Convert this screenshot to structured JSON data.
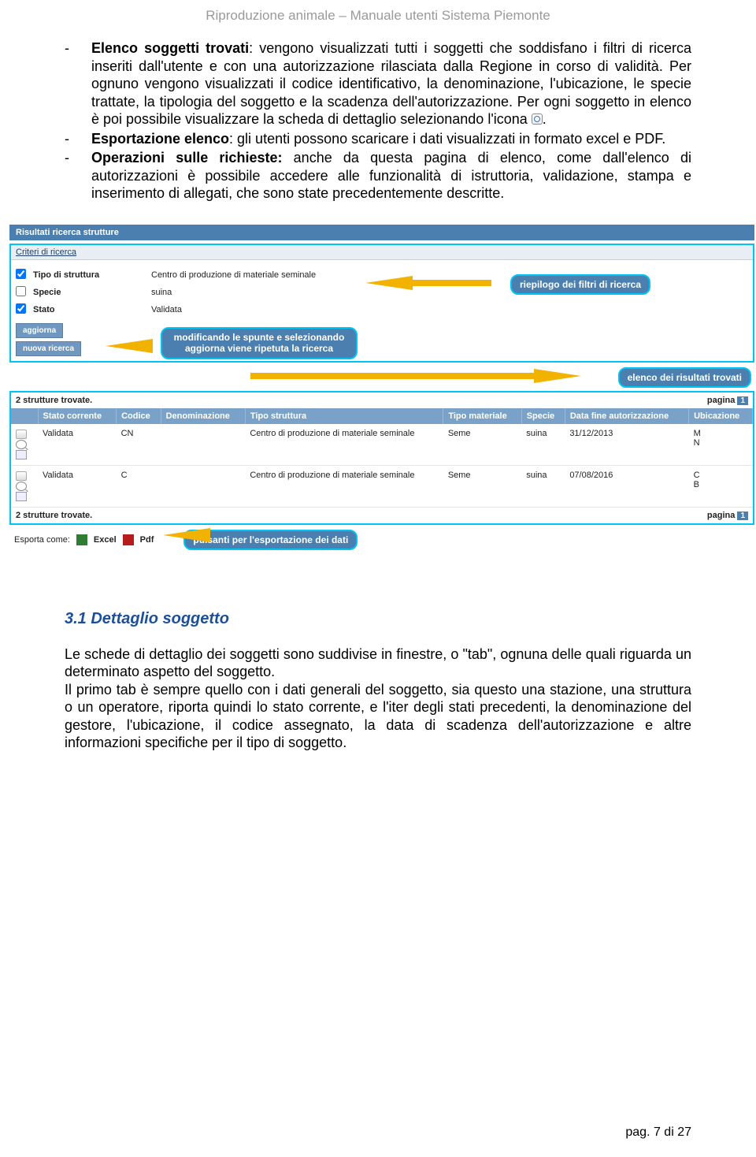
{
  "header": {
    "title": "Riproduzione animale – Manuale utenti Sistema Piemonte"
  },
  "bullets": [
    {
      "lead": "Elenco soggetti trovati",
      "rest": ": vengono visualizzati tutti i soggetti che soddisfano i filtri di ricerca inseriti dall'utente e con una autorizzazione rilasciata dalla Regione in corso di validità. Per ognuno vengono visualizzati il codice identificativo, la denominazione, l'ubicazione, le specie trattate, la tipologia del soggetto e la scadenza dell'autorizzazione. Per ogni soggetto in elenco è poi possibile visualizzare la scheda di dettaglio selezionando l'icona "
    },
    {
      "lead": "Esportazione elenco",
      "rest": ": gli utenti possono scaricare i dati visualizzati in formato excel e PDF."
    },
    {
      "lead": "Operazioni sulle richieste:",
      "rest": " anche da questa pagina di elenco, come dall'elenco di autorizzazioni è possibile accedere alle funzionalità di istruttoria, validazione, stampa e inserimento di allegati, che sono state precedentemente descritte."
    }
  ],
  "screenshot": {
    "title_bar": "Risultati ricerca strutture",
    "criteri": {
      "header": "Criteri di ricerca",
      "rows": [
        {
          "checked": true,
          "label": "Tipo di struttura",
          "value": "Centro di produzione di materiale seminale"
        },
        {
          "checked": false,
          "label": "Specie",
          "value": "suina"
        },
        {
          "checked": true,
          "label": "Stato",
          "value": "Validata"
        }
      ],
      "btn_aggiorna": "aggiorna",
      "btn_nuova": "nuova ricerca"
    },
    "callouts": {
      "riepilogo": "riepilogo dei filtri di ricerca",
      "modificando": "modificando le spunte e selezionando aggiorna viene ripetuta la ricerca",
      "elenco": "elenco dei risultati trovati",
      "export": "pulsanti per l'esportazione dei dati"
    },
    "results": {
      "count_text": "2 strutture trovate.",
      "pagina_label": "pagina",
      "pagina_num": "1",
      "columns": [
        "",
        "Stato corrente",
        "Codice",
        "Denominazione",
        "Tipo struttura",
        "Tipo materiale",
        "Specie",
        "Data fine autorizzazione",
        "Ubicazione"
      ],
      "rows": [
        {
          "stato": "Validata",
          "codice": "CN",
          "denom": "",
          "tipo_strut": "Centro di produzione di materiale seminale",
          "tipo_mat": "Seme",
          "specie": "suina",
          "data_fine": "31/12/2013",
          "ubic": "M\nN"
        },
        {
          "stato": "Validata",
          "codice": "C",
          "denom": "",
          "tipo_strut": "Centro di produzione di materiale seminale",
          "tipo_mat": "Seme",
          "specie": "suina",
          "data_fine": "07/08/2016",
          "ubic": "C\nB"
        }
      ]
    },
    "export": {
      "label": "Esporta come:",
      "excel": "Excel",
      "pdf": "Pdf"
    }
  },
  "section": {
    "heading": "3.1  Dettaglio soggetto",
    "para": "Le schede di dettaglio dei soggetti sono suddivise in finestre, o \"tab\", ognuna delle quali riguarda un determinato aspetto del soggetto.\nIl primo tab è sempre quello con i dati generali del soggetto, sia questo una stazione, una struttura o un operatore, riporta quindi lo stato corrente, e l'iter degli stati precedenti, la denominazione del gestore, l'ubicazione, il codice assegnato, la data di scadenza dell'autorizzazione e altre informazioni specifiche per il tipo di soggetto."
  },
  "footer": {
    "text": "pag. 7 di 27"
  }
}
